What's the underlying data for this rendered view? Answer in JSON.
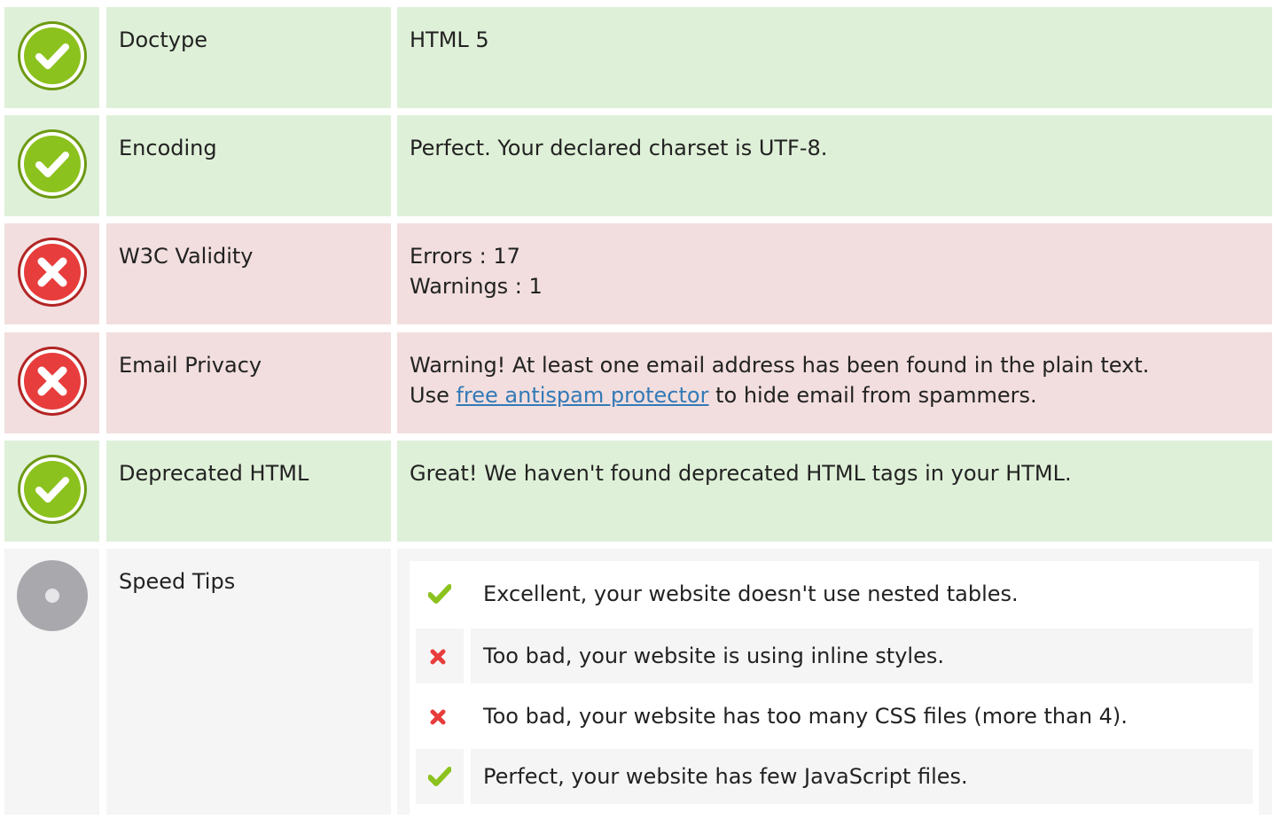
{
  "colors": {
    "ok_bg": "#dff0d8",
    "bad_bg": "#f2dede",
    "neutral_bg": "#f5f5f5",
    "ok_icon": "#8cc21e",
    "bad_icon": "#e83d3d",
    "link": "#337ab7"
  },
  "rows": [
    {
      "status": "ok",
      "icon": "check-circle-icon",
      "label": "Doctype",
      "lines": [
        "HTML 5"
      ]
    },
    {
      "status": "ok",
      "icon": "check-circle-icon",
      "label": "Encoding",
      "lines": [
        "Perfect. Your declared charset is UTF-8."
      ]
    },
    {
      "status": "bad",
      "icon": "x-circle-icon",
      "label": "W3C Validity",
      "lines": [
        "Errors : 17",
        "Warnings : 1"
      ]
    },
    {
      "status": "bad",
      "icon": "x-circle-icon",
      "label": "Email Privacy",
      "line1": "Warning! At least one email address has been found in the plain text.",
      "line2_prefix": "Use ",
      "line2_link": "free antispam protector",
      "line2_suffix": " to hide email from spammers."
    },
    {
      "status": "ok",
      "icon": "check-circle-icon",
      "label": "Deprecated HTML",
      "lines": [
        "Great! We haven't found deprecated HTML tags in your HTML."
      ]
    },
    {
      "status": "neutral",
      "icon": "neutral-circle-icon",
      "label": "Speed Tips",
      "tips": [
        {
          "status": "ok",
          "icon": "checkmark-icon",
          "text": "Excellent, your website doesn't use nested tables."
        },
        {
          "status": "bad",
          "icon": "cross-icon",
          "text": "Too bad, your website is using inline styles."
        },
        {
          "status": "bad",
          "icon": "cross-icon",
          "text": "Too bad, your website has too many CSS files (more than 4)."
        },
        {
          "status": "ok",
          "icon": "checkmark-icon",
          "text": "Perfect, your website has few JavaScript files."
        }
      ]
    }
  ]
}
